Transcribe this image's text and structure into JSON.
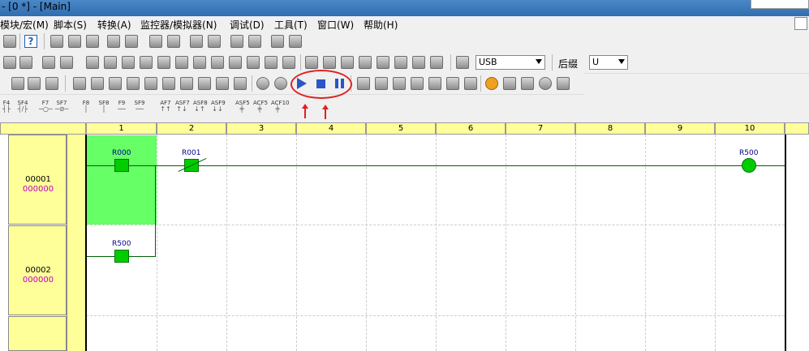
{
  "window": {
    "title": "- [0 *] - [Main]"
  },
  "menu": [
    "模块/宏(M)",
    "脚本(S)",
    "转换(A)",
    "监控器/模拟器(N)",
    "调试(D)",
    "工具(T)",
    "窗口(W)",
    "帮助(H)"
  ],
  "toolbar": {
    "port_select": "USB",
    "suffix_label": "后缀",
    "suffix_select": "U"
  },
  "fkeys": [
    {
      "label": "F4",
      "sym": "┤├"
    },
    {
      "label": "SF4",
      "sym": "┤/├"
    },
    {
      "label": "F7",
      "sym": "─○─"
    },
    {
      "label": "SF7",
      "sym": "─⊘─"
    },
    {
      "label": "F8",
      "sym": "│"
    },
    {
      "label": "SF8",
      "sym": "│"
    },
    {
      "label": "F9",
      "sym": "──"
    },
    {
      "label": "SF9",
      "sym": "──"
    },
    {
      "label": "AF7",
      "sym": "↑↑"
    },
    {
      "label": "ASF7",
      "sym": "↑↓"
    },
    {
      "label": "ASF8",
      "sym": "↓↑"
    },
    {
      "label": "ASF9",
      "sym": "↓↓"
    },
    {
      "label": "ASF5",
      "sym": "╪"
    },
    {
      "label": "ACF5",
      "sym": "╪"
    },
    {
      "label": "ACF10",
      "sym": "╪"
    }
  ],
  "columns": [
    "1",
    "2",
    "3",
    "4",
    "5",
    "6",
    "7",
    "8",
    "9",
    "10"
  ],
  "rows": [
    {
      "num": "00001",
      "addr": "000000"
    },
    {
      "num": "00002",
      "addr": "000000"
    }
  ],
  "ladder": {
    "r1_c1": "R000",
    "r1_c2": "R001",
    "r1_coil": "R500",
    "r2_c1": "R500"
  },
  "colors": {
    "energized": "#66ff66",
    "contact": "#00cc00",
    "header": "#ffff99",
    "annotation": "#e02020"
  }
}
